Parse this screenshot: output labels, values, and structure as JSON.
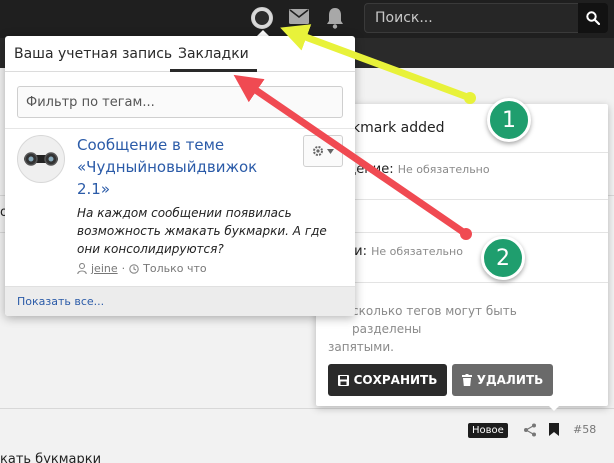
{
  "header": {
    "search_placeholder": "Поиск..."
  },
  "dropdown": {
    "tabs": [
      {
        "label": "Ваша учетная запись",
        "active": false
      },
      {
        "label": "Закладки",
        "active": true
      }
    ],
    "filter_placeholder": "Фильтр по тегам...",
    "bookmark": {
      "title": "Сообщение в теме «Чудныйновыйдвижок 2.1»",
      "snippet": "На каждом сообщении появилась возможность жмакать букмарки. А где они консолидируются?",
      "author": "jeine",
      "time": "Только что"
    },
    "show_all": "Показать все..."
  },
  "edit_panel": {
    "added_text": "kmark added",
    "message_label": "бщение:",
    "message_hint": "Не обязательно",
    "labels_label": "ыки:",
    "labels_hint": "Не обязательно",
    "help_line1": "сколько тегов могут быть разделены",
    "help_line2": "запятыми.",
    "save_label": "СОХРАНИТЬ",
    "delete_label": "УДАЛИТЬ"
  },
  "background": {
    "left_fragment": "о",
    "post_badge": "Новое",
    "post_number": "#58",
    "bottom_text": "кать букмарки"
  },
  "annotations": {
    "marker1": "1",
    "marker2": "2",
    "arrow1_color": "#e8f23a",
    "arrow2_color": "#f04a52",
    "marker_color": "#1f9e6e"
  }
}
